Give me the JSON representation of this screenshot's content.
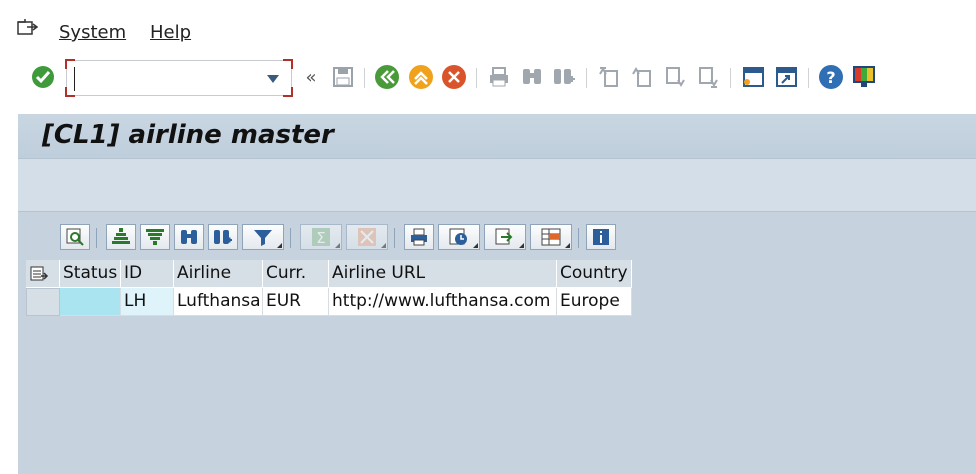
{
  "menubar": {
    "items": [
      {
        "label": "System"
      },
      {
        "label": "Help"
      }
    ]
  },
  "toolbar": {
    "command_field_value": "",
    "icons": [
      "enter-icon",
      "command-field-arrow-icon",
      "collapse-icon",
      "save-icon",
      "back-icon",
      "exit-icon",
      "cancel-icon",
      "print-icon",
      "find-icon",
      "find-next-icon",
      "first-page-icon",
      "previous-page-icon",
      "next-page-icon",
      "last-page-icon",
      "create-session-icon",
      "shortcut-icon",
      "help-icon",
      "layout-menu-icon"
    ]
  },
  "page": {
    "title": "[CL1] airline master"
  },
  "alv_toolbar": {
    "buttons": [
      "details",
      "sort-ascending",
      "sort-descending",
      "find",
      "find-next",
      "filter",
      "total",
      "subtotals",
      "print",
      "views",
      "export",
      "layout",
      "information"
    ]
  },
  "grid": {
    "columns": [
      "Status",
      "ID",
      "Airline",
      "Curr.",
      "Airline URL",
      "Country"
    ],
    "rows": [
      {
        "status": "",
        "id": "LH",
        "airline": "Lufthansa",
        "currency": "EUR",
        "url": "http://www.lufthansa.com",
        "country": "Europe"
      }
    ]
  },
  "colors": {
    "background": "#c6d3df",
    "status_cell": "#a9e4f0",
    "accent_red": "#b0302a"
  }
}
